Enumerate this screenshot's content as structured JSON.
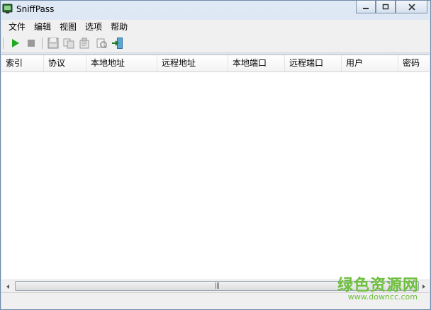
{
  "window": {
    "title": "SniffPass"
  },
  "menu": [
    "文件",
    "编辑",
    "视图",
    "选项",
    "帮助"
  ],
  "toolbar": {
    "icons": [
      "start-capture-icon",
      "stop-capture-icon",
      "save-icon",
      "copy-icon",
      "properties-icon",
      "html-report-icon",
      "exit-icon"
    ]
  },
  "columns": [
    "索引",
    "协议",
    "本地地址",
    "远程地址",
    "本地端口",
    "远程端口",
    "用户",
    "密码"
  ],
  "rows": [],
  "watermark": {
    "text": "绿色资源网",
    "url": "www.downcc.com"
  }
}
